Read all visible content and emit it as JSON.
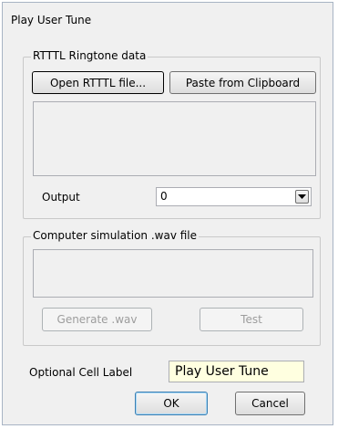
{
  "window": {
    "title": "Play User Tune"
  },
  "rtttl_group": {
    "legend": "RTTTL Ringtone data",
    "open_button": "Open RTTTL file...",
    "paste_button": "Paste from Clipboard",
    "data_text": ""
  },
  "output": {
    "label": "Output",
    "selected": "0"
  },
  "wav_group": {
    "legend": "Computer simulation .wav file",
    "wav_text": "",
    "generate_button": "Generate .wav",
    "test_button": "Test"
  },
  "cell_label": {
    "label": "Optional Cell Label",
    "value": "Play User Tune"
  },
  "footer": {
    "ok_button": "OK",
    "cancel_button": "Cancel"
  },
  "colors": {
    "dialog_bg": "#f0f0f0",
    "cell_input_bg": "#ffffe0"
  }
}
